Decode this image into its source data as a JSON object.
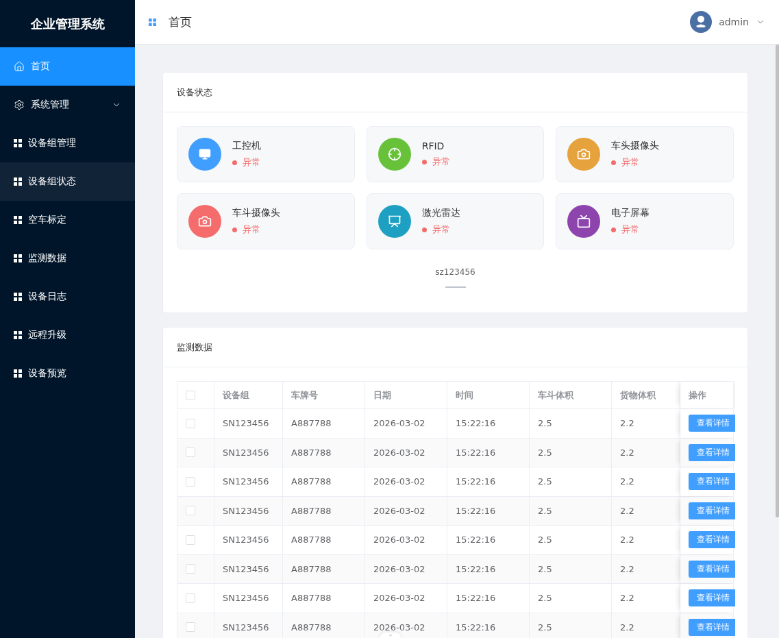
{
  "sidebar": {
    "title": "企业管理系统",
    "items": [
      {
        "label": "首页",
        "kind": "home",
        "selected": true,
        "highlighted": false
      },
      {
        "label": "系统管理",
        "kind": "gear",
        "selected": false,
        "highlighted": false,
        "expanded": false
      },
      {
        "label": "设备组管理",
        "kind": "grid",
        "selected": false,
        "highlighted": false
      },
      {
        "label": "设备组状态",
        "kind": "grid",
        "selected": false,
        "highlighted": true
      },
      {
        "label": "空车标定",
        "kind": "grid",
        "selected": false,
        "highlighted": false
      },
      {
        "label": "监测数据",
        "kind": "grid",
        "selected": false,
        "highlighted": false
      },
      {
        "label": "设备日志",
        "kind": "grid",
        "selected": false,
        "highlighted": false
      },
      {
        "label": "远程升级",
        "kind": "grid",
        "selected": false,
        "highlighted": false
      },
      {
        "label": "设备预览",
        "kind": "grid",
        "selected": false,
        "highlighted": false
      }
    ]
  },
  "header": {
    "title": "首页",
    "user": "admin"
  },
  "device_status": {
    "title": "设备状态",
    "devices": [
      {
        "name": "工控机",
        "status": "异常",
        "kind": "computer",
        "color": "#409eff"
      },
      {
        "name": "RFID",
        "status": "异常",
        "kind": "target",
        "color": "#67c23a"
      },
      {
        "name": "车头摄像头",
        "status": "异常",
        "kind": "camera",
        "color": "#e6a23c"
      },
      {
        "name": "车斗摄像头",
        "status": "异常",
        "kind": "camera",
        "color": "#f56c6c"
      },
      {
        "name": "激光雷达",
        "status": "异常",
        "kind": "board",
        "color": "#1ea0c3"
      },
      {
        "name": "电子屏幕",
        "status": "异常",
        "kind": "screen",
        "color": "#8e44ad"
      }
    ],
    "group": "sz123456"
  },
  "monitor_data": {
    "title": "监测数据",
    "columns": [
      "设备组",
      "车牌号",
      "日期",
      "时间",
      "车斗体积",
      "货物体积",
      "操作"
    ],
    "rows": [
      {
        "checked": false,
        "cells": [
          "SN123456",
          "A887788",
          "2026-03-02",
          "15:22:16",
          "2.5",
          "2.2"
        ],
        "action": "查看详情"
      },
      {
        "checked": false,
        "cells": [
          "SN123456",
          "A887788",
          "2026-03-02",
          "15:22:16",
          "2.5",
          "2.2"
        ],
        "action": "查看详情"
      },
      {
        "checked": false,
        "cells": [
          "SN123456",
          "A887788",
          "2026-03-02",
          "15:22:16",
          "2.5",
          "2.2"
        ],
        "action": "查看详情"
      },
      {
        "checked": false,
        "cells": [
          "SN123456",
          "A887788",
          "2026-03-02",
          "15:22:16",
          "2.5",
          "2.2"
        ],
        "action": "查看详情"
      },
      {
        "checked": false,
        "cells": [
          "SN123456",
          "A887788",
          "2026-03-02",
          "15:22:16",
          "2.5",
          "2.2"
        ],
        "action": "查看详情"
      },
      {
        "checked": false,
        "cells": [
          "SN123456",
          "A887788",
          "2026-03-02",
          "15:22:16",
          "2.5",
          "2.2"
        ],
        "action": "查看详情"
      },
      {
        "checked": false,
        "cells": [
          "SN123456",
          "A887788",
          "2026-03-02",
          "15:22:16",
          "2.5",
          "2.2"
        ],
        "action": "查看详情"
      },
      {
        "checked": false,
        "cells": [
          "SN123456",
          "A887788",
          "2026-03-02",
          "15:22:16",
          "2.5",
          "2.2"
        ],
        "action": "查看详情"
      }
    ],
    "all_checked": false
  }
}
